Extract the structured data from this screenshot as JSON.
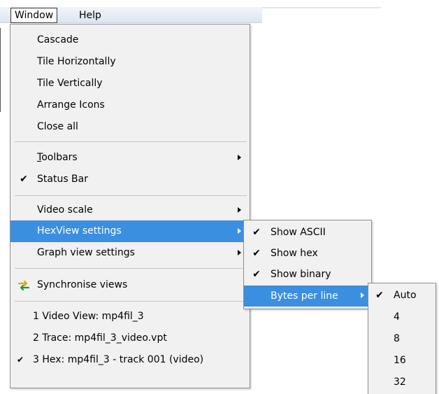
{
  "menubar": {
    "window": "Window",
    "help": "Help"
  },
  "window_menu": {
    "group1": [
      "Cascade",
      "Tile Horizontally",
      "Tile Vertically",
      "Arrange Icons",
      "Close all"
    ],
    "toolbars": {
      "mnemonic": "T",
      "rest": "oolbars"
    },
    "status_bar": "Status Bar",
    "video_scale": "Video scale",
    "hexview_settings": "HexView settings",
    "graph_view_settings": "Graph view settings",
    "synchronise_views": "Synchronise views",
    "windows": [
      "1 Video View: mp4fil_3",
      "2 Trace: mp4fil_3_video.vpt",
      "3 Hex: mp4fil_3 - track 001 (video)"
    ],
    "check_glyph": "✔"
  },
  "hexview_submenu": {
    "show_ascii": "Show ASCII",
    "show_hex": "Show hex",
    "show_binary": "Show binary",
    "bytes_per_line": "Bytes per line"
  },
  "bytes_per_line_submenu": [
    "Auto",
    "4",
    "8",
    "16",
    "32"
  ],
  "colors": {
    "highlight": "#3b8fe0",
    "menu_bg": "#f1f1f1"
  }
}
